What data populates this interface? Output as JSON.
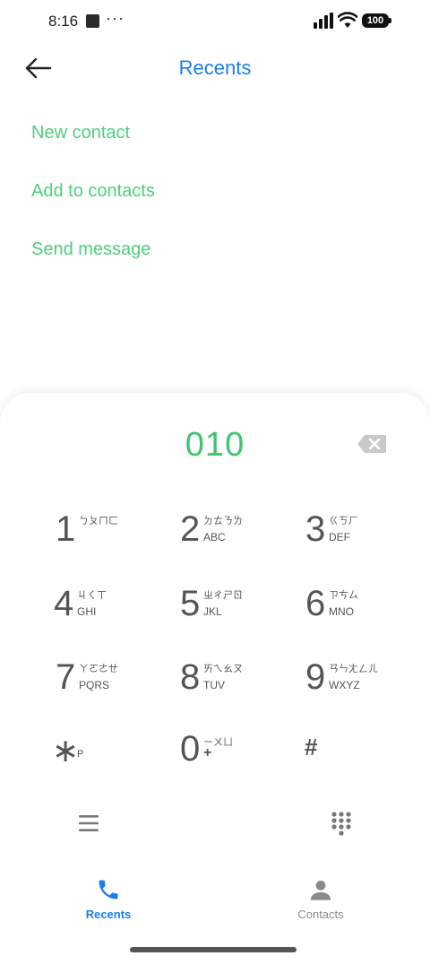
{
  "status_bar": {
    "time": "8:16",
    "more": "···",
    "battery": "100"
  },
  "header": {
    "title": "Recents",
    "back_icon": "arrow-left-icon"
  },
  "actions": [
    {
      "label": "New contact"
    },
    {
      "label": "Add to contacts"
    },
    {
      "label": "Send message"
    }
  ],
  "dialpad": {
    "number": "010",
    "keys": [
      {
        "digit": "1",
        "zhuyin": "ㄅㄆㄇㄈ",
        "letters": ""
      },
      {
        "digit": "2",
        "zhuyin": "ㄉㄊㄋㄌ",
        "letters": "ABC"
      },
      {
        "digit": "3",
        "zhuyin": "ㄍㄎㄏ",
        "letters": "DEF"
      },
      {
        "digit": "4",
        "zhuyin": "ㄐㄑㄒ",
        "letters": "GHI"
      },
      {
        "digit": "5",
        "zhuyin": "ㄓㄔㄕㄖ",
        "letters": "JKL"
      },
      {
        "digit": "6",
        "zhuyin": "ㄗㄘㄙ",
        "letters": "MNO"
      },
      {
        "digit": "7",
        "zhuyin": "ㄚㄛㄜㄝ",
        "letters": "PQRS"
      },
      {
        "digit": "8",
        "zhuyin": "ㄞㄟㄠㄡ",
        "letters": "TUV"
      },
      {
        "digit": "9",
        "zhuyin": "ㄢㄣㄤㄥㄦ",
        "letters": "WXYZ"
      },
      {
        "digit": "∗",
        "zhuyin": "",
        "letters": "P"
      },
      {
        "digit": "0",
        "zhuyin": "ㄧㄨㄩ",
        "letters": "+"
      },
      {
        "digit": "#",
        "zhuyin": "",
        "letters": ""
      }
    ]
  },
  "bottom_nav": [
    {
      "label": "Recents",
      "icon": "phone-icon",
      "active": true
    },
    {
      "label": "Contacts",
      "icon": "person-icon",
      "active": false
    }
  ],
  "colors": {
    "accent_blue": "#1a7fe6",
    "action_green": "#4cd07a",
    "number_green": "#3fc46f"
  }
}
